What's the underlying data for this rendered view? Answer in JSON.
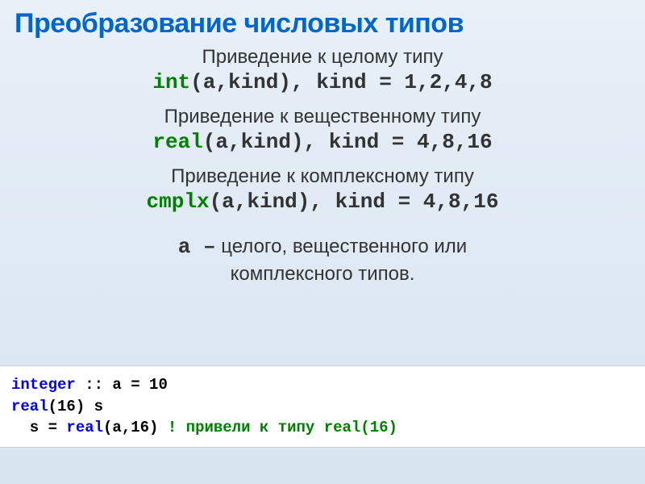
{
  "title": "Преобразование числовых типов",
  "sections": {
    "int": {
      "label": "Приведение к целому типу",
      "func": "int",
      "args": "(a,kind),",
      "spacer": "  ",
      "kind": "kind = 1,2,4,8"
    },
    "real": {
      "label": "Приведение к вещественному типу",
      "func": "real",
      "args": "(a,kind), ",
      "kind": "kind = 4,8,16"
    },
    "cmplx": {
      "label": "Приведение к комплексному типу",
      "func": "cmplx",
      "args": "(a,kind), ",
      "kind": "kind = 4,8,16"
    }
  },
  "desc": {
    "prefix": "a –",
    "rest_line1": " целого, вещественного или",
    "rest_line2": "комплексного типов."
  },
  "code": {
    "line1_keyword": "integer",
    "line1_rest": " :: a = 10",
    "line2_keyword": "real",
    "line2_rest": "(16) s",
    "line3_prefix": "  s = ",
    "line3_func": "real",
    "line3_args": "(a,16) ",
    "line3_comment": "! привели к типу real(16)"
  }
}
